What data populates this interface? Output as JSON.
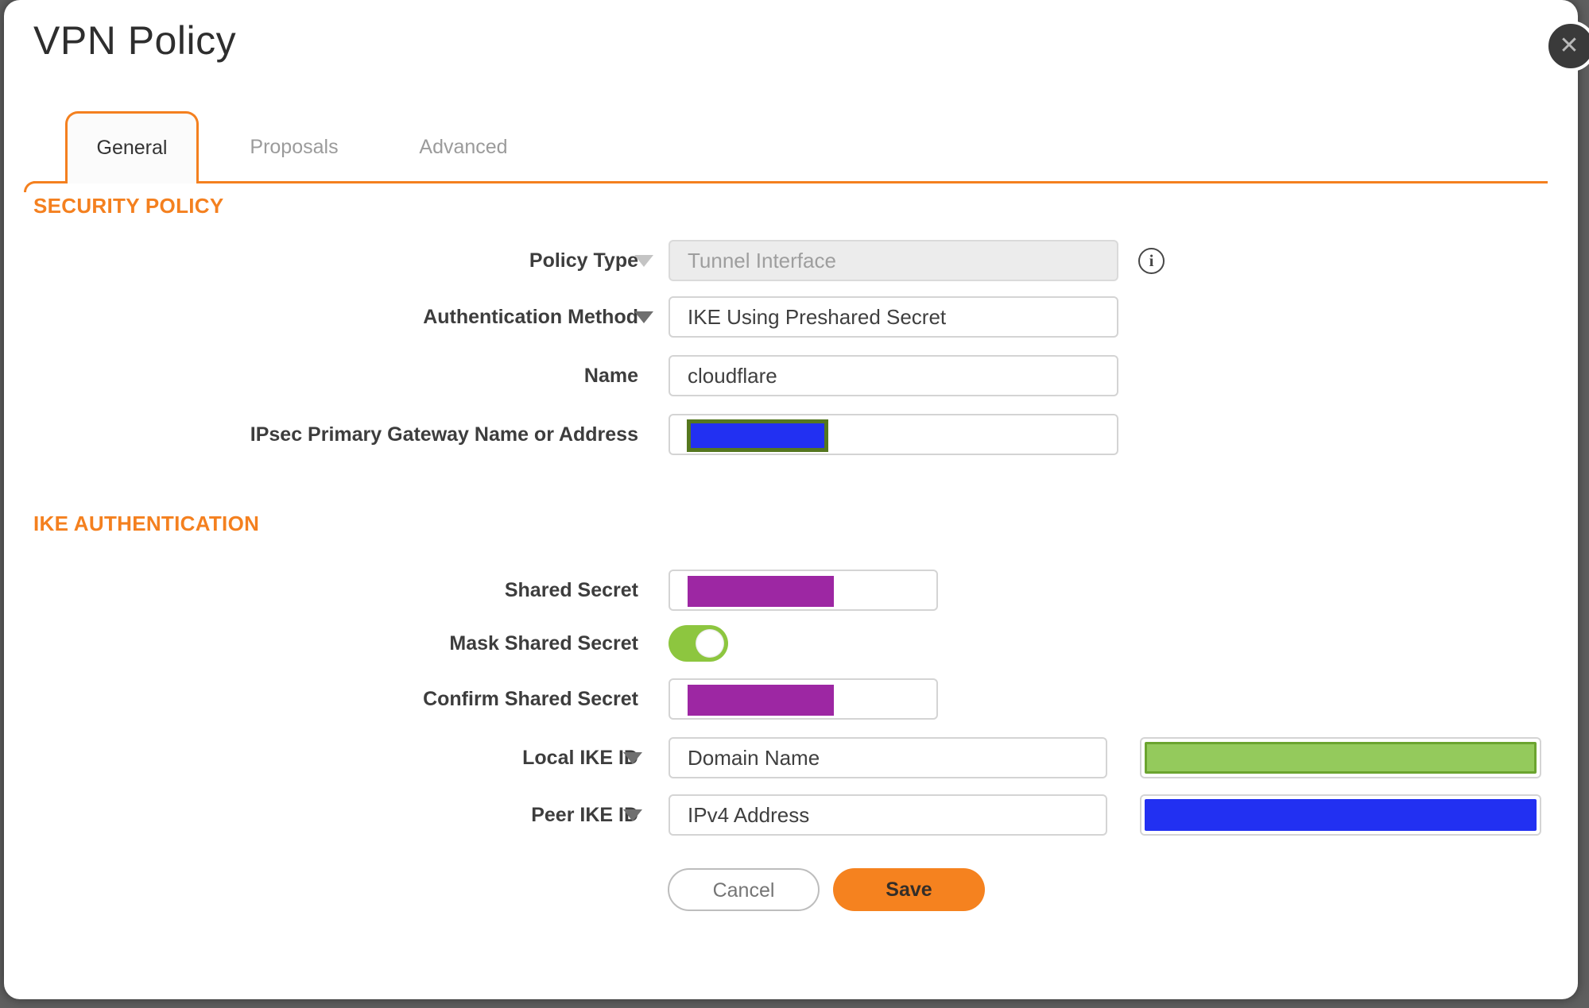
{
  "window": {
    "title": "VPN Policy"
  },
  "icons": {
    "close": "✕",
    "info": "i",
    "chevron_down": "css-triangle"
  },
  "tabs": {
    "general": "General",
    "proposals": "Proposals",
    "advanced": "Advanced",
    "active_tab": "General"
  },
  "sections": {
    "security_policy": "SECURITY POLICY",
    "ike_authentication": "IKE AUTHENTICATION"
  },
  "fields": {
    "policy_type": {
      "label": "Policy Type",
      "value": "Tunnel Interface",
      "state": "disabled"
    },
    "authentication_method": {
      "label": "Authentication Method",
      "value": "IKE Using Preshared Secret"
    },
    "name": {
      "label": "Name",
      "value": "cloudflare"
    },
    "gateway": {
      "label": "IPsec Primary Gateway Name or Address",
      "value_masked": true
    },
    "shared_secret": {
      "label": "Shared Secret",
      "value_masked": true
    },
    "mask_shared_secret": {
      "label": "Mask Shared Secret",
      "state": "on"
    },
    "confirm_shared_secret": {
      "label": "Confirm Shared Secret",
      "value_masked": true
    },
    "local_ike_id": {
      "label": "Local IKE ID",
      "value": "Domain Name",
      "id_value_masked": true
    },
    "peer_ike_id": {
      "label": "Peer IKE ID",
      "value": "IPv4 Address",
      "id_value_masked": true
    }
  },
  "buttons": {
    "cancel": "Cancel",
    "save": "Save"
  },
  "colors": {
    "accent_orange": "#F4801F",
    "save_orange": "#F5821F",
    "toggle_green": "#8DC63F",
    "redaction_purple": "#9D27A3",
    "redaction_blue": "#2230F2",
    "redaction_green_fill": "#94CA5C",
    "redaction_green_border": "#6BA42F",
    "redaction_olive_border": "#55771F",
    "backdrop_gray": "#5F5F5F"
  }
}
